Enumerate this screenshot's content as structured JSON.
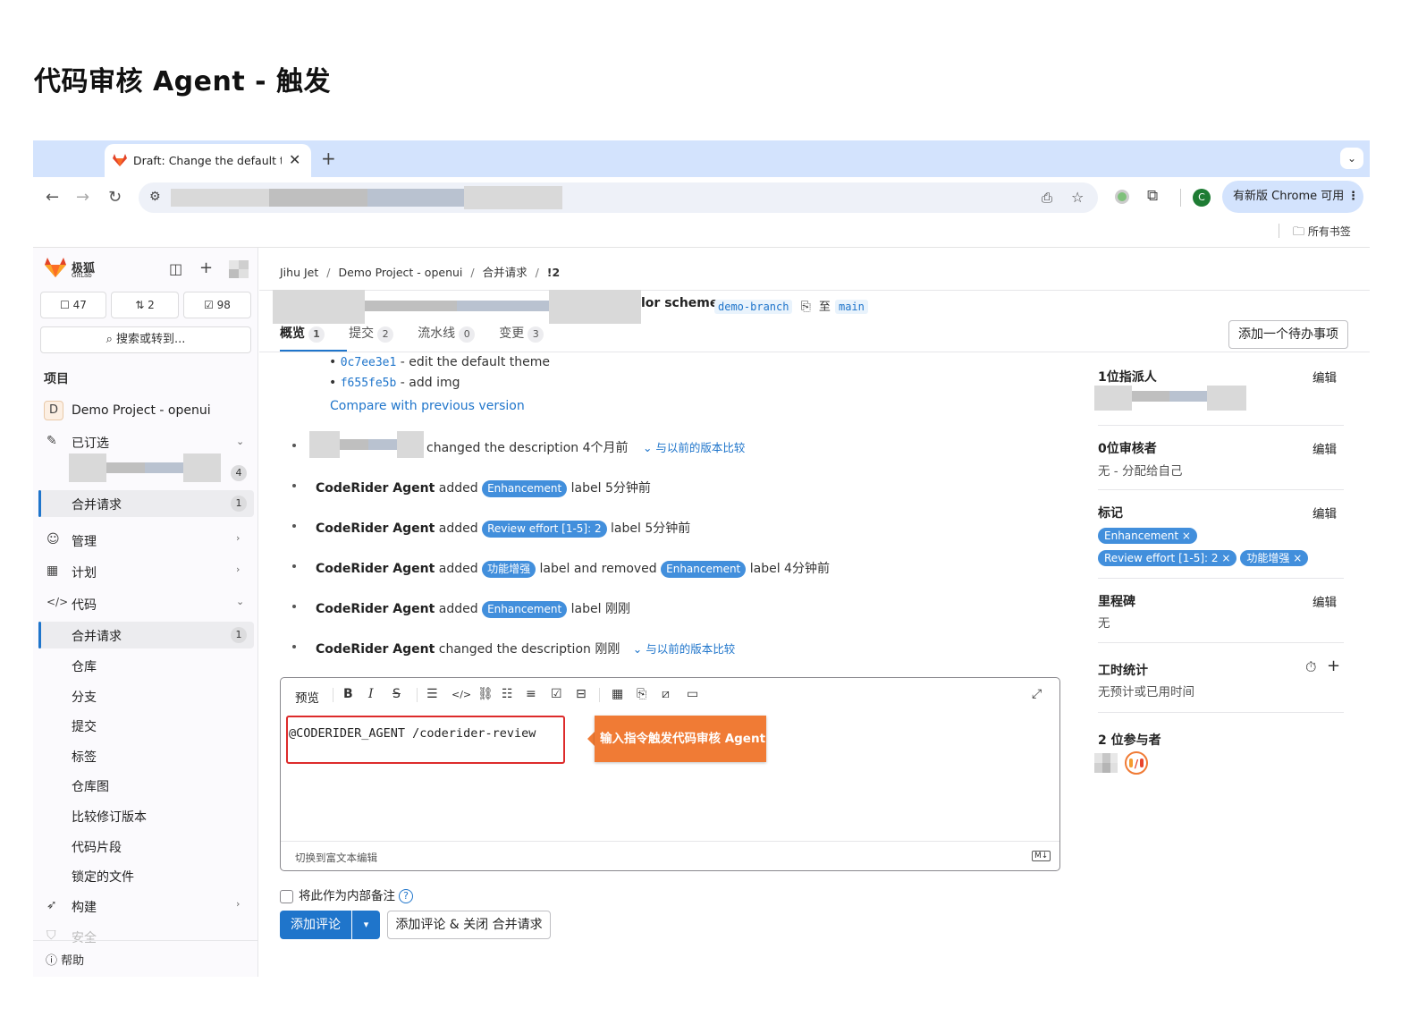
{
  "page_title": "代码审核 Agent - 触发",
  "browser": {
    "tab_title": "Draft: Change the default theme",
    "new_tab": "+",
    "tab_close": "✕",
    "update_label": "有新版 Chrome 可用",
    "profile_letter": "C",
    "bookmarks_label": "所有书签"
  },
  "sidebar": {
    "logo_text": "极狐",
    "logo_subtext": "GitLab",
    "counts": {
      "issues": "47",
      "merge_requests": "2",
      "todos": "98"
    },
    "search_label": "搜索或转到...",
    "section_heading": "项目",
    "project_badge": "D",
    "project_name": "Demo Project - openui",
    "pinned_label": "已订选",
    "pinned_count": "4",
    "pinned_mr_label": "合并请求",
    "pinned_mr_count": "1",
    "nav": {
      "manage": "管理",
      "plan": "计划",
      "code": "代码",
      "code_mr": "合并请求",
      "code_mr_count": "1",
      "repository": "仓库",
      "branches": "分支",
      "commits": "提交",
      "tags": "标签",
      "repo_graph": "仓库图",
      "compare": "比较修订版本",
      "snippets": "代码片段",
      "locked_files": "锁定的文件",
      "build": "构建",
      "security": "安全"
    },
    "help_label": "帮助"
  },
  "main": {
    "breadcrumb": [
      "Jihu Jet",
      "Demo Project - openui",
      "合并请求",
      "!2"
    ],
    "mr_title_tail": "lor scheme",
    "source_branch": "demo-branch",
    "to_label": "至",
    "target_branch": "main",
    "tabs": [
      {
        "label": "概览",
        "count": "1"
      },
      {
        "label": "提交",
        "count": "2"
      },
      {
        "label": "流水线",
        "count": "0"
      },
      {
        "label": "变更",
        "count": "3"
      }
    ],
    "todo_button": "添加一个待办事项",
    "commits": [
      {
        "sha": "0c7ee3e1",
        "msg": "- edit the default theme"
      },
      {
        "sha": "f655fe5b",
        "msg": "- add img"
      }
    ],
    "compare_link": "Compare with previous version",
    "activity": {
      "a1_text": "changed the description 4个月前",
      "a1_link": "与以前的版本比较",
      "actor": "CodeRider Agent",
      "added": "added",
      "label_word": "label",
      "and_removed": "label and removed",
      "a2_label": "Enhancement",
      "a2_time": "5分钟前",
      "a3_label": "Review effort [1-5]: 2",
      "a3_time": "5分钟前",
      "a4_label1": "功能增强",
      "a4_label2": "Enhancement",
      "a4_time": "4分钟前",
      "a5_label": "Enhancement",
      "a5_time": "刚刚",
      "a6_text": "changed the description 刚刚",
      "a6_link": "与以前的版本比较"
    },
    "editor": {
      "preview": "预览",
      "command": "@CODERIDER_AGENT /coderider-review",
      "switch_label": "切换到富文本编辑",
      "md_badge": "M↓",
      "callout": "输入指令触发代码审核 Agent"
    },
    "internal_note": "将此作为内部备注",
    "add_comment": "添加评论",
    "add_and_close": "添加评论 & 关闭 合并请求"
  },
  "right_sidebar": {
    "edit_label": "编辑",
    "assignee_title": "1位指派人",
    "reviewer_title": "0位审核者",
    "reviewer_value": "无 - 分配给自己",
    "labels_title": "标记",
    "labels": [
      "Enhancement ×",
      "Review effort [1-5]: 2 ×",
      "功能增强 ×"
    ],
    "milestone_title": "里程碑",
    "milestone_value": "无",
    "time_title": "工时统计",
    "time_value": "无预计或已用时间",
    "participants_title": "2 位参与者"
  },
  "colors": {
    "accent": "#1f75cb",
    "label_bg": "#428fdc",
    "callout": "#f07b35",
    "highlight_border": "#dd2b2b"
  }
}
